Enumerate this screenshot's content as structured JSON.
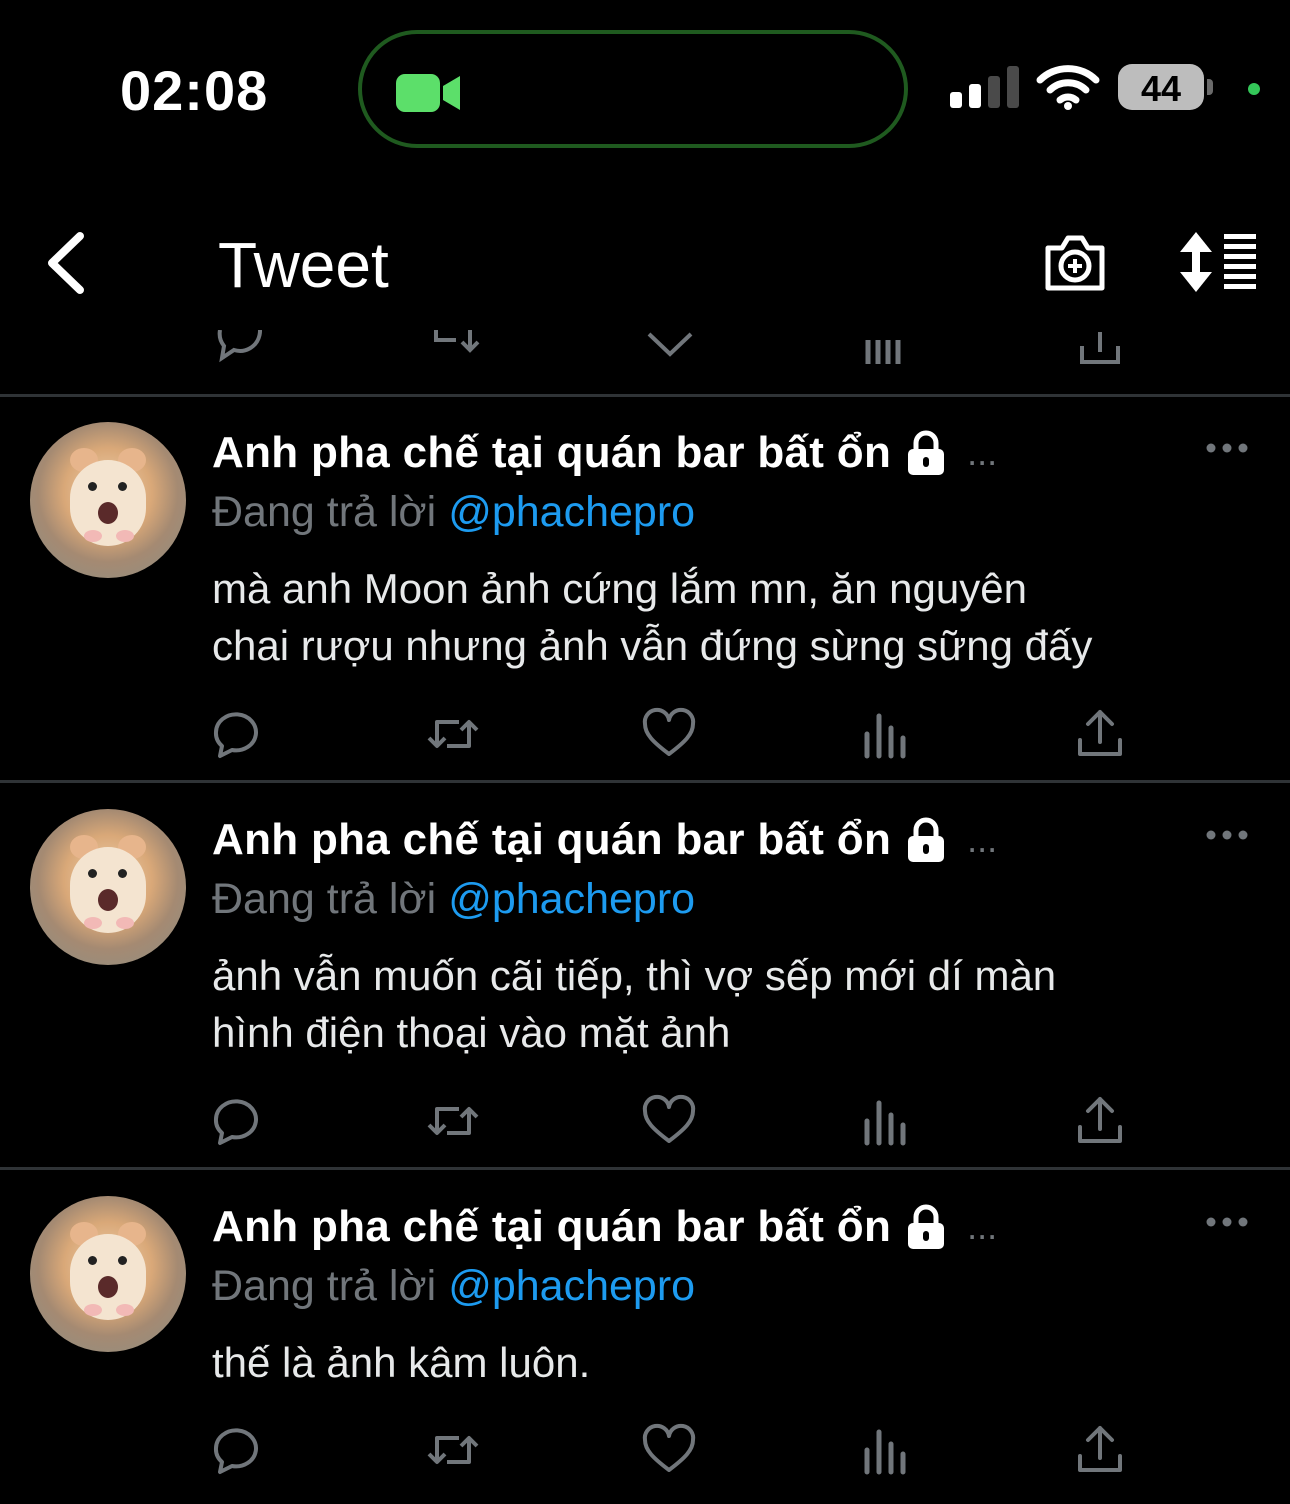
{
  "status": {
    "time": "02:08",
    "battery": "44",
    "signal_bars_active": 2,
    "signal_bars_total": 4
  },
  "header": {
    "title": "Tweet"
  },
  "colors": {
    "accent_blue": "#1d9bf0",
    "muted": "#71767b",
    "divider": "#2f3336",
    "facetime_green": "#5cdf6a"
  },
  "tweets": [
    {
      "display_name": "Anh pha chế tại quán bar bất ổn",
      "ellipsis": "...",
      "reply_label": "Đang trả lời",
      "reply_handle": "@phachepro",
      "text_line1": "mà anh Moon ảnh cứng lắm mn, ăn nguyên",
      "text_line2": "chai rượu nhưng ảnh vẫn đứng sừng sững đấy"
    },
    {
      "display_name": "Anh pha chế tại quán bar bất ổn",
      "ellipsis": "...",
      "reply_label": "Đang trả lời",
      "reply_handle": "@phachepro",
      "text_line1": "ảnh vẫn muốn cãi tiếp, thì vợ sếp mới dí màn",
      "text_line2": "hình điện thoại vào mặt ảnh"
    },
    {
      "display_name": "Anh pha chế tại quán bar bất ổn",
      "ellipsis": "...",
      "reply_label": "Đang trả lời",
      "reply_handle": "@phachepro",
      "text_line1": "thế là ảnh kâm luôn.",
      "text_line2": ""
    }
  ],
  "icons": {
    "back": "chevron-left-icon",
    "camera_add": "camera-plus-icon",
    "sort": "sort-icon",
    "lock": "lock-icon",
    "more": "more-horizontal-icon",
    "reply": "reply-icon",
    "retweet": "retweet-icon",
    "like": "heart-icon",
    "views": "analytics-icon",
    "share": "share-icon"
  }
}
